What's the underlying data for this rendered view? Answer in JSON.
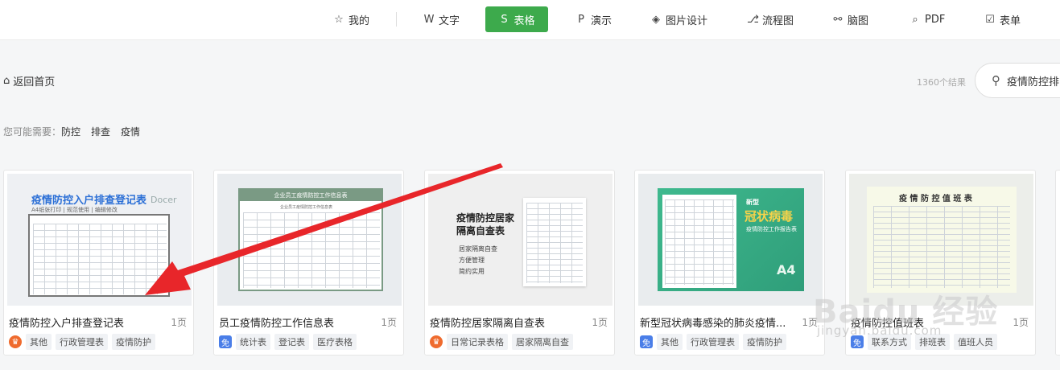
{
  "nav": {
    "items": [
      {
        "label": "我的",
        "icon": "star-icon",
        "glyph": "☆"
      },
      {
        "label": "文字",
        "icon": "word-icon",
        "glyph": "W"
      },
      {
        "label": "表格",
        "icon": "sheet-icon",
        "glyph": "S",
        "active": true
      },
      {
        "label": "演示",
        "icon": "presentation-icon",
        "glyph": "P"
      },
      {
        "label": "图片设计",
        "icon": "image-design-icon",
        "glyph": "◈"
      },
      {
        "label": "流程图",
        "icon": "flowchart-icon",
        "glyph": "⎇"
      },
      {
        "label": "脑图",
        "icon": "mindmap-icon",
        "glyph": "⚯"
      },
      {
        "label": "PDF",
        "icon": "pdf-icon",
        "glyph": "⌕"
      },
      {
        "label": "表单",
        "icon": "form-icon",
        "glyph": "☑"
      }
    ],
    "active_color": "#3daa4c"
  },
  "back": {
    "label": "返回首页",
    "glyph": "⌂"
  },
  "results": {
    "count": "1360个结果"
  },
  "search": {
    "value": "疫情防控排",
    "glyph": "⚲"
  },
  "suggest": {
    "prefix": "您可能需要：",
    "tags": [
      "防控",
      "排查",
      "疫情"
    ]
  },
  "cards": [
    {
      "title": "疫情防控入户排查登记表",
      "pages": "1页",
      "badge": "vip",
      "tags": [
        "其他",
        "行政管理表",
        "疫情防护"
      ],
      "thumb": {
        "heading": "疫情防控入户排查登记表",
        "sub": "A4纸张打印 | 规范使用 | 编辑修改",
        "brand": "Docer"
      }
    },
    {
      "title": "员工疫情防控工作信息表",
      "pages": "1页",
      "badge": "free",
      "tags": [
        "统计表",
        "登记表",
        "医疗表格"
      ],
      "thumb": {
        "heading": "企业员工疫情防控工作信息表",
        "sub": "企业员工疫情防控工作信息表"
      }
    },
    {
      "title": "疫情防控居家隔离自查表",
      "pages": "1页",
      "badge": "vip",
      "tags": [
        "日常记录表格",
        "居家隔离自查"
      ],
      "thumb": {
        "heading": "疫情防控居家隔离自查表",
        "bullets": [
          "居家隔离自查",
          "方便管理",
          "简约实用"
        ]
      }
    },
    {
      "title": "新型冠状病毒感染的肺炎疫情...",
      "pages": "1页",
      "badge": "free",
      "tags": [
        "其他",
        "行政管理表",
        "疫情防护"
      ],
      "thumb": {
        "heading1": "新型",
        "heading2": "冠状病毒",
        "heading3": "疫情防控工作报告表",
        "paper": "A4"
      }
    },
    {
      "title": "疫情防控值班表",
      "pages": "1页",
      "badge": "free",
      "tags": [
        "联系方式",
        "排班表",
        "值班人员"
      ],
      "thumb": {
        "heading": "疫 情 防 控 值 班 表"
      }
    }
  ],
  "badge_glyphs": {
    "vip": "♛",
    "free": "免"
  },
  "watermark": {
    "main": "Baidu 经验",
    "sub": "jingyan.baidu.com"
  }
}
